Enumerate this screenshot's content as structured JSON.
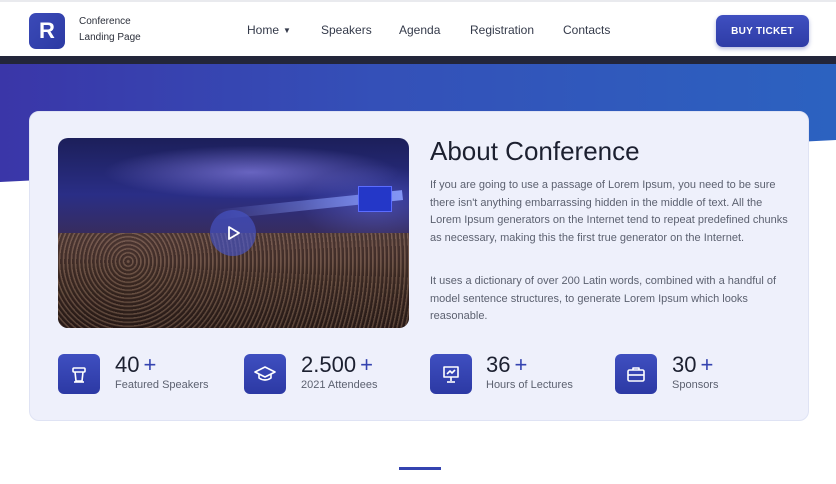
{
  "brand": {
    "logo_letter": "R",
    "line1": "Conference",
    "line2": "Landing Page"
  },
  "nav": {
    "items": [
      {
        "label": "Home",
        "has_dropdown": true
      },
      {
        "label": "Speakers"
      },
      {
        "label": "Agenda"
      },
      {
        "label": "Registration"
      },
      {
        "label": "Contacts"
      }
    ],
    "cta_label": "BUY TICKET"
  },
  "about": {
    "title": "About Conference",
    "paragraph1": "If you are going to use a passage of Lorem Ipsum, you need to be sure there isn't anything embarrassing hidden in the middle of text. All the Lorem Ipsum generators on the Internet tend to repeat predefined chunks as necessary, making this the first true generator on the Internet.",
    "paragraph2": "It uses a dictionary of over 200 Latin words, combined with a handful of model sentence structures, to generate Lorem Ipsum which looks reasonable."
  },
  "stats": [
    {
      "number": "40",
      "suffix": "+",
      "label": "Featured Speakers",
      "icon": "podium-icon"
    },
    {
      "number": "2.500",
      "suffix": "+",
      "label": "2021 Attendees",
      "icon": "graduation-cap-icon"
    },
    {
      "number": "36",
      "suffix": "+",
      "label": "Hours of Lectures",
      "icon": "presentation-board-icon"
    },
    {
      "number": "30",
      "suffix": "+",
      "label": "Sponsors",
      "icon": "briefcase-icon"
    }
  ],
  "colors": {
    "primary": "#3443b0",
    "band_start": "#3a36a8",
    "band_end": "#2c62c0",
    "card_bg": "#eef0fb"
  }
}
